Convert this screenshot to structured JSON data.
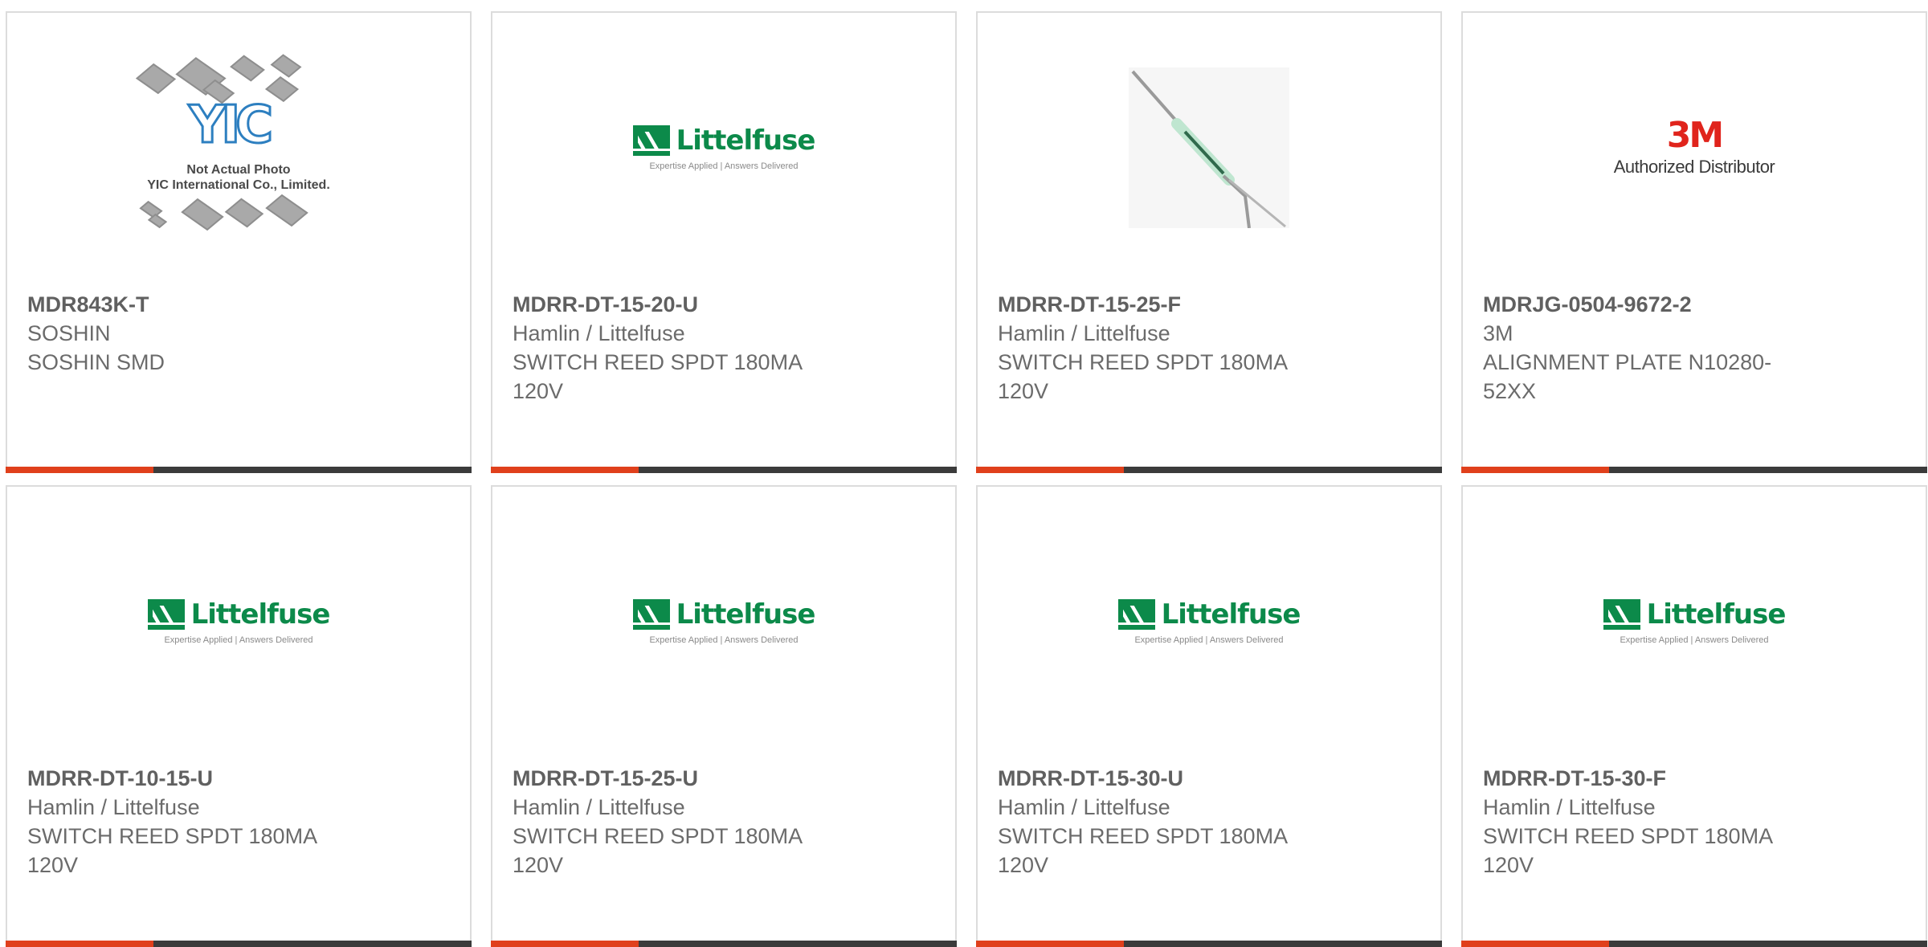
{
  "products": [
    {
      "part_number": "MDR843K-T",
      "manufacturer": "SOSHIN",
      "description": "SOSHIN SMD",
      "image": "yic-not-actual-photo",
      "image_text": [
        "Not Actual Photo",
        "YIC International Co., Limited."
      ],
      "image_logo": "YIC"
    },
    {
      "part_number": "MDRR-DT-15-20-U",
      "manufacturer": "Hamlin / Littelfuse",
      "description": "SWITCH REED SPDT 180MA 120V",
      "image": "littelfuse-logo"
    },
    {
      "part_number": "MDRR-DT-15-25-F",
      "manufacturer": "Hamlin / Littelfuse",
      "description": "SWITCH REED SPDT 180MA 120V",
      "image": "reed-switch-photo"
    },
    {
      "part_number": "MDRJG-0504-9672-2",
      "manufacturer": "3M",
      "description": "ALIGNMENT PLATE N10280-52XX",
      "image": "3m-logo"
    },
    {
      "part_number": "MDRR-DT-10-15-U",
      "manufacturer": "Hamlin / Littelfuse",
      "description": "SWITCH REED SPDT 180MA 120V",
      "image": "littelfuse-logo"
    },
    {
      "part_number": "MDRR-DT-15-25-U",
      "manufacturer": "Hamlin / Littelfuse",
      "description": "SWITCH REED SPDT 180MA 120V",
      "image": "littelfuse-logo"
    },
    {
      "part_number": "MDRR-DT-15-30-U",
      "manufacturer": "Hamlin / Littelfuse",
      "description": "SWITCH REED SPDT 180MA 120V",
      "image": "littelfuse-logo"
    },
    {
      "part_number": "MDRR-DT-15-30-F",
      "manufacturer": "Hamlin / Littelfuse",
      "description": "SWITCH REED SPDT 180MA 120V",
      "image": "littelfuse-logo"
    }
  ],
  "logos": {
    "littelfuse_name": "Littelfuse",
    "littelfuse_tagline": "Expertise Applied | Answers Delivered",
    "mm_name": "3M",
    "mm_sub": "Authorized Distributor"
  },
  "colors": {
    "accent_bar": "#e0401c",
    "dark_bar": "#3b3b3b",
    "littelfuse_green": "#0c8a4a",
    "mm_red": "#e0241c"
  }
}
